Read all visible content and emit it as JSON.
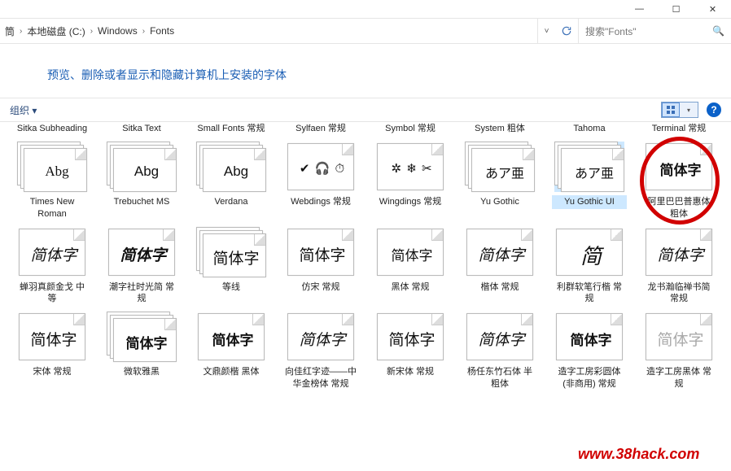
{
  "window": {
    "minimize": "—",
    "maximize": "☐",
    "close": "✕"
  },
  "breadcrumb": {
    "p0": "筒",
    "p1": "本地磁盘 (C:)",
    "p2": "Windows",
    "p3": "Fonts",
    "sep": "›"
  },
  "search": {
    "placeholder": "搜索\"Fonts\""
  },
  "heading": "预览、删除或者显示和隐藏计算机上安装的字体",
  "toolbar": {
    "organize": "组织 ▾"
  },
  "row0": {
    "i0": "Sitka Subheading",
    "i1": "Sitka Text",
    "i2": "Small Fonts 常规",
    "i3": "Sylfaen 常规",
    "i4": "Symbol 常规",
    "i5": "System 粗体",
    "i6": "Tahoma",
    "i7": "Terminal 常规"
  },
  "row1": {
    "i0": {
      "label": "Times New Roman",
      "sample": "Abg"
    },
    "i1": {
      "label": "Trebuchet MS",
      "sample": "Abg"
    },
    "i2": {
      "label": "Verdana",
      "sample": "Abg"
    },
    "i3": {
      "label": "Webdings 常规",
      "sample": "✔ 🎧 ⏱"
    },
    "i4": {
      "label": "Wingdings 常规",
      "sample": "✲ ❄ ✂"
    },
    "i5": {
      "label": "Yu Gothic",
      "sample": "あア亜"
    },
    "i6": {
      "label": "Yu Gothic UI",
      "sample": "あア亜"
    },
    "i7": {
      "label": "阿里巴巴普惠体 粗体",
      "sample": "简体字"
    }
  },
  "row2": {
    "i0": {
      "label": "蝉羽真颜金戈 中等",
      "sample": "简体字"
    },
    "i1": {
      "label": "潮字社时光简 常规",
      "sample": "简体字"
    },
    "i2": {
      "label": "等线",
      "sample": "简体字"
    },
    "i3": {
      "label": "仿宋 常规",
      "sample": "简体字"
    },
    "i4": {
      "label": "黑体 常规",
      "sample": "简体字"
    },
    "i5": {
      "label": "楷体 常规",
      "sample": "简体字"
    },
    "i6": {
      "label": "利群软笔行楷 常规",
      "sample": "简"
    },
    "i7": {
      "label": "龙书瀚临禅书简 常规",
      "sample": "简体字"
    }
  },
  "row3": {
    "i0": {
      "label": "宋体 常规",
      "sample": "简体字"
    },
    "i1": {
      "label": "微软雅黑",
      "sample": "简体字"
    },
    "i2": {
      "label": "文鼎颜楷 黑体",
      "sample": "简体字"
    },
    "i3": {
      "label": "向佳红字迹——中华金榜体 常规",
      "sample": "简体字"
    },
    "i4": {
      "label": "新宋体 常规",
      "sample": "简体字"
    },
    "i5": {
      "label": "杨任东竹石体 半粗体",
      "sample": "简体字"
    },
    "i6": {
      "label": "造字工房彩圆体(非商用) 常规",
      "sample": "简体字"
    },
    "i7": {
      "label": "造字工房黑体 常规",
      "sample": "简体字"
    }
  },
  "watermark": "www.38hack.com"
}
